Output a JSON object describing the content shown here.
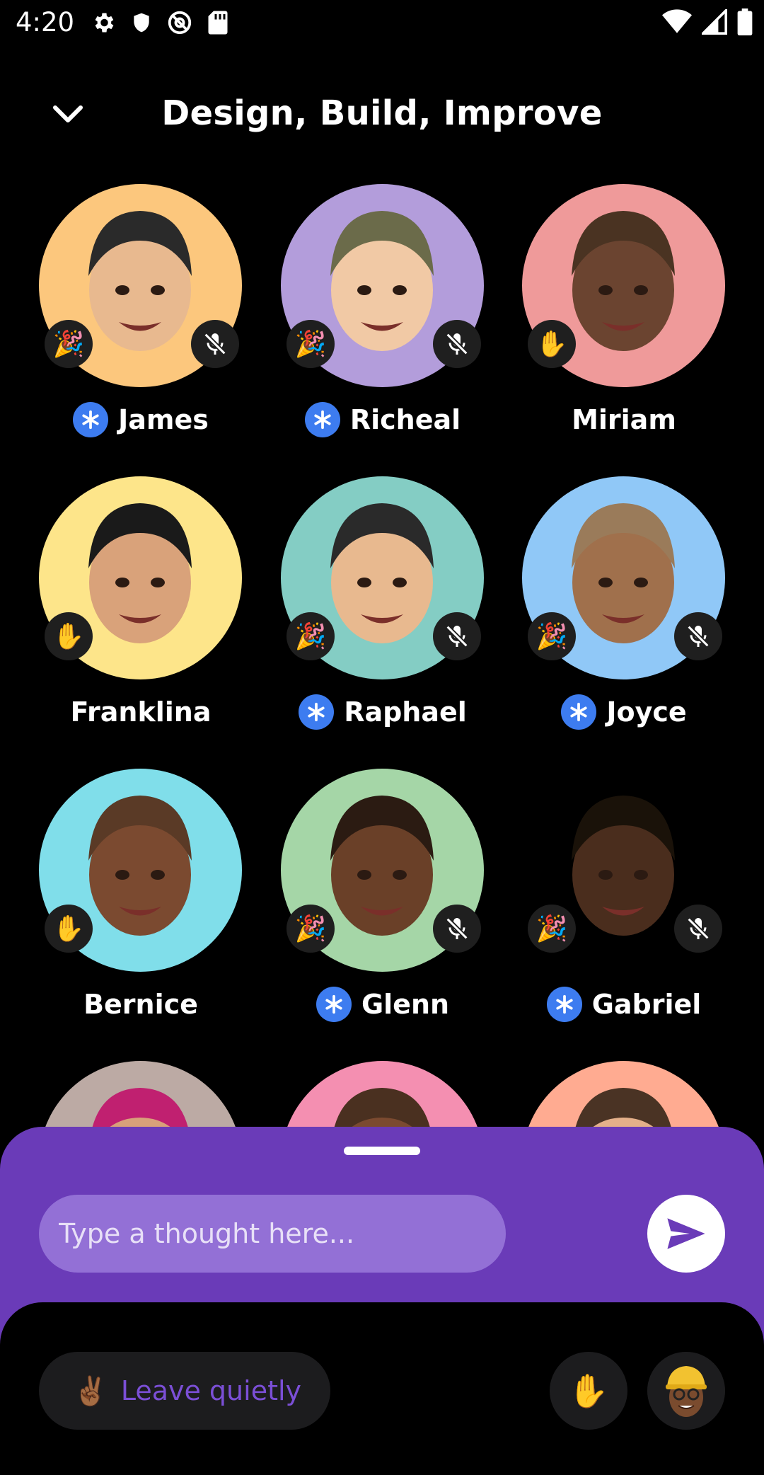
{
  "status_bar": {
    "time": "4:20",
    "left_icons": [
      "settings-icon",
      "shield-icon",
      "at-sign-icon",
      "sd-card-icon"
    ],
    "right_icons": [
      "wifi-icon",
      "signal-icon",
      "battery-icon"
    ]
  },
  "header": {
    "title": "Design, Build, Improve",
    "back_icon": "chevron-down-icon"
  },
  "participants": [
    {
      "name": "James",
      "moderator": true,
      "bg": "#fcc77d",
      "left_badge": "🎉",
      "muted": true
    },
    {
      "name": "Richeal",
      "moderator": true,
      "bg": "#b39ddb",
      "left_badge": "🎉",
      "muted": true
    },
    {
      "name": "Miriam",
      "moderator": false,
      "bg": "#ef9a9a",
      "left_badge": "✋",
      "muted": false
    },
    {
      "name": "Franklina",
      "moderator": false,
      "bg": "#fde58a",
      "left_badge": "✋",
      "muted": false
    },
    {
      "name": "Raphael",
      "moderator": true,
      "bg": "#84cdc4",
      "left_badge": "🎉",
      "muted": true
    },
    {
      "name": "Joyce",
      "moderator": true,
      "bg": "#90c8f7",
      "left_badge": "🎉",
      "muted": true
    },
    {
      "name": "Bernice",
      "moderator": false,
      "bg": "#80deea",
      "left_badge": "✋",
      "muted": false
    },
    {
      "name": "Glenn",
      "moderator": true,
      "bg": "#a5d6a7",
      "left_badge": "🎉",
      "muted": true
    },
    {
      "name": "Gabriel",
      "moderator": true,
      "bg": "#000000",
      "left_badge": "🎉",
      "muted": true
    },
    {
      "name": "",
      "moderator": false,
      "bg": "#bcaaa4",
      "left_badge": "",
      "muted": false
    },
    {
      "name": "",
      "moderator": false,
      "bg": "#f48fb1",
      "left_badge": "",
      "muted": false
    },
    {
      "name": "",
      "moderator": false,
      "bg": "#ffab91",
      "left_badge": "",
      "muted": false
    }
  ],
  "composer": {
    "placeholder": "Type a thought here...",
    "send_icon": "send-icon"
  },
  "footer": {
    "leave_emoji": "✌🏾",
    "leave_label": "Leave quietly",
    "raise_hand_emoji": "✋"
  },
  "colors": {
    "sheet": "#6a3bb8",
    "moderator_badge": "#3d7cf0",
    "leave_text": "#7b4fd6"
  }
}
